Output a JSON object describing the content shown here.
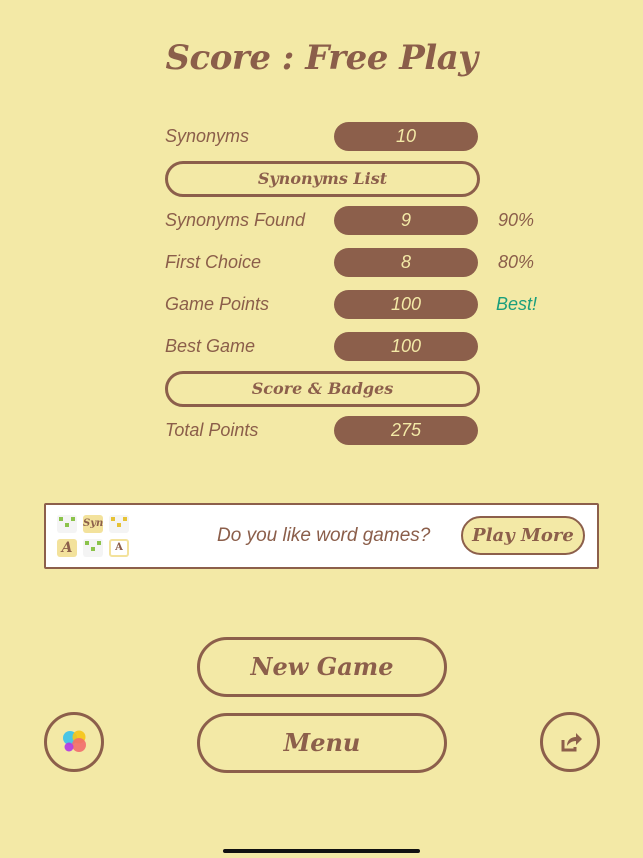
{
  "title": "Score : Free Play",
  "stats": [
    {
      "label": "Synonyms",
      "value": "10",
      "extra": ""
    },
    {
      "label": "Synonyms Found",
      "value": "9",
      "extra": "90%"
    },
    {
      "label": "First Choice",
      "value": "8",
      "extra": "80%"
    },
    {
      "label": "Game Points",
      "value": "100",
      "extra": "Best!"
    },
    {
      "label": "Best Game",
      "value": "100",
      "extra": ""
    },
    {
      "label": "Total Points",
      "value": "275",
      "extra": ""
    }
  ],
  "buttons": {
    "synonyms_list": "Synonyms List",
    "score_badges": "Score & Badges",
    "new_game": "New Game",
    "menu": "Menu"
  },
  "ad": {
    "question": "Do you like word games?",
    "play_more": "Play More",
    "icons": [
      "grid-game-icon",
      "syn-game-icon",
      "grid-game-icon",
      "a-script-icon",
      "grid-game-icon",
      "a-tile-icon"
    ],
    "icon_labels": {
      "syn": "Syn",
      "a_script": "A",
      "a_tile": "A"
    }
  },
  "icons": {
    "game_center": "game-center-icon",
    "share": "share-icon"
  },
  "colors": {
    "background": "#f3e9a6",
    "brown": "#8c5f4b",
    "best_green": "#1a9e7c"
  }
}
